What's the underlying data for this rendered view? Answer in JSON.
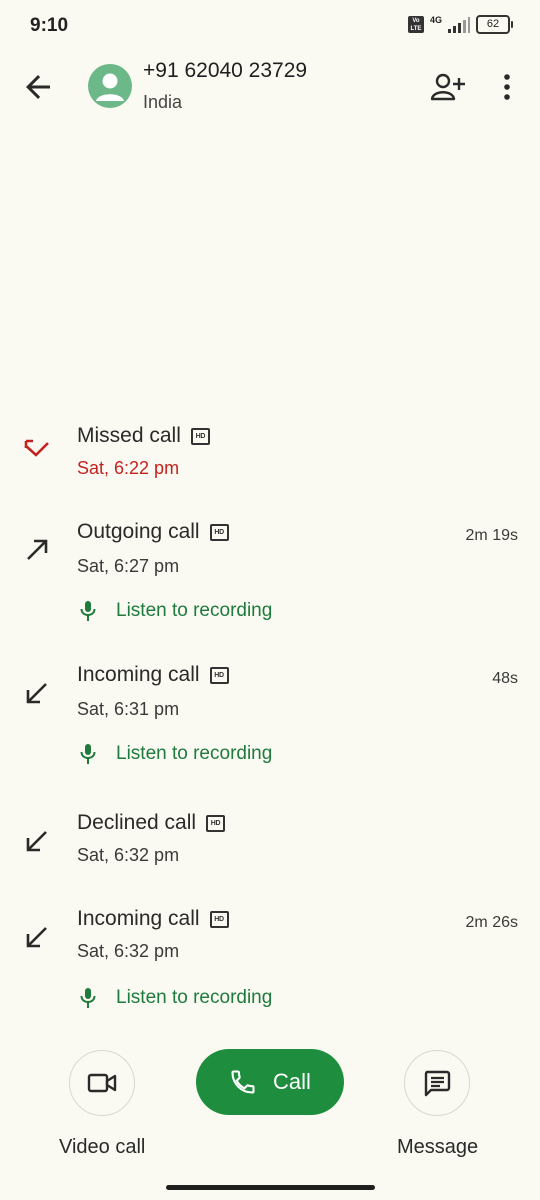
{
  "status_bar": {
    "time": "9:10",
    "volte": [
      "Vo",
      "LTE"
    ],
    "network": "4G",
    "battery": "62"
  },
  "contact": {
    "number": "+91 62040 23729",
    "country": "India"
  },
  "call_log": [
    {
      "type": "Missed call",
      "time": "Sat, 6:22 pm",
      "duration": "",
      "recording": ""
    },
    {
      "type": "Outgoing call",
      "time": "Sat, 6:27 pm",
      "duration": "2m 19s",
      "recording": "Listen to recording"
    },
    {
      "type": "Incoming call",
      "time": "Sat, 6:31 pm",
      "duration": "48s",
      "recording": "Listen to recording"
    },
    {
      "type": "Declined call",
      "time": "Sat, 6:32 pm",
      "duration": "",
      "recording": ""
    },
    {
      "type": "Incoming call",
      "time": "Sat, 6:32 pm",
      "duration": "2m 26s",
      "recording": "Listen to recording"
    }
  ],
  "actions": {
    "video_call": "Video call",
    "call": "Call",
    "message": "Message"
  },
  "colors": {
    "background": "#fafaf2",
    "accent_green": "#1e8e3e",
    "missed_red": "#c5221f",
    "recording_green": "#1e7a3d",
    "avatar": "#6cb888"
  },
  "icons": {
    "back": "arrow-left-icon",
    "avatar": "person-icon",
    "add_contact": "person-add-icon",
    "more": "more-vert-icon",
    "missed": "missed-call-icon",
    "outgoing": "outgoing-call-icon",
    "incoming": "incoming-call-icon",
    "hd": "hd-icon",
    "mic": "mic-icon",
    "video": "videocam-icon",
    "phone": "phone-icon",
    "message": "message-icon"
  }
}
